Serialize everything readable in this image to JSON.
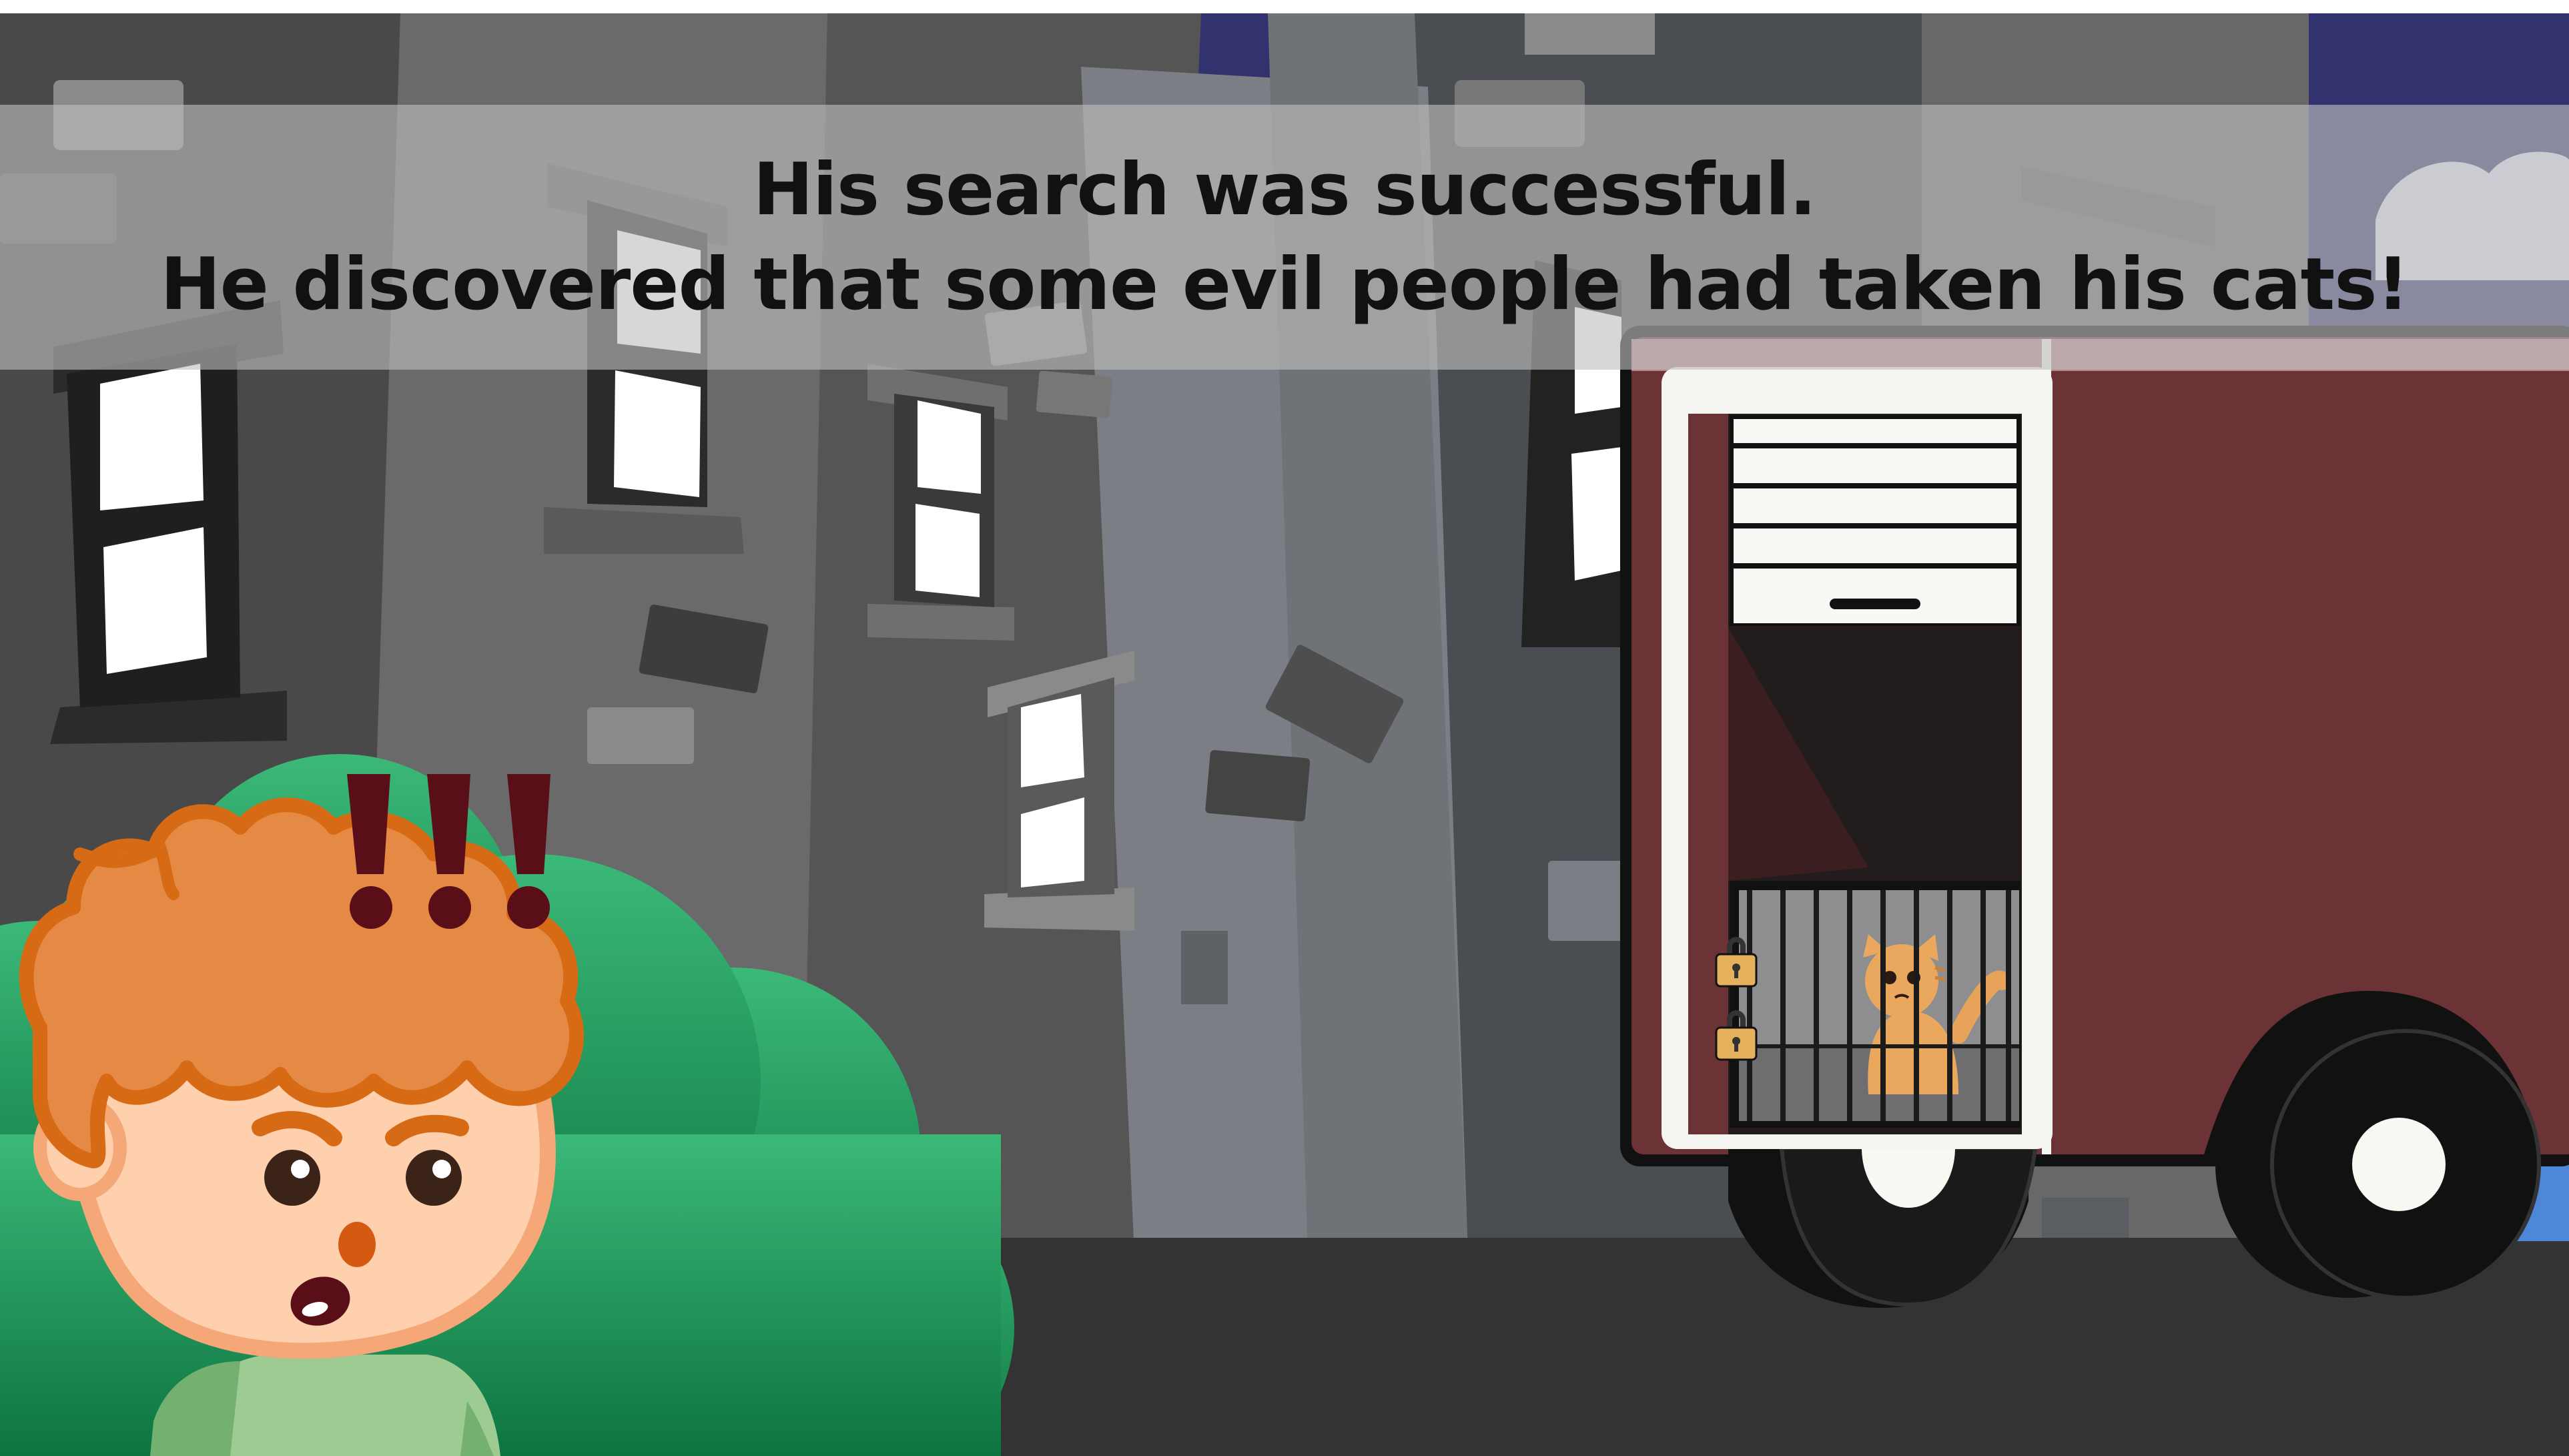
{
  "dialogue": {
    "line1": "His search was successful.",
    "line2": "He discovered that some evil people had taken his cats!"
  },
  "character": {
    "exclamation": "!!!"
  },
  "icons": {
    "boy": "surprised-boy-character",
    "cat": "caged-orange-cat",
    "truck": "maroon-cargo-truck",
    "padlock": "padlock-icon"
  },
  "colors": {
    "sky": "#33336e",
    "truck_body": "#6b3335",
    "hair": "#e48a44",
    "bush": "#22a062",
    "exclamation": "#5a0e17"
  }
}
